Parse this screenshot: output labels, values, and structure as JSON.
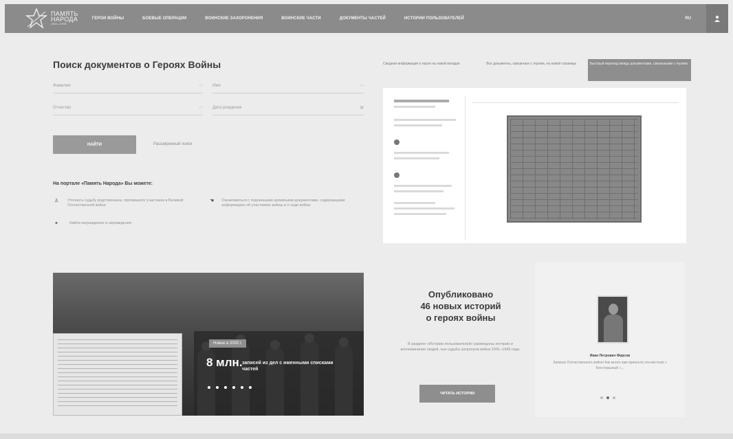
{
  "header": {
    "logo": {
      "line1": "Память",
      "line2": "Народа",
      "line3": "1941–1945"
    },
    "nav": [
      "Герои войны",
      "Боевые операции",
      "Воинские захоронения",
      "Воинские части",
      "Документы частей",
      "Истории пользователей"
    ],
    "lang": "RU"
  },
  "search": {
    "title": "Поиск документов о Героях Войны",
    "fields": {
      "last_name": "Фамилия",
      "first_name": "Имя",
      "patronymic": "Отчество",
      "birth_date": "Дата рождения"
    },
    "find_button": "Найти",
    "advanced_link": "Расширенный поиск"
  },
  "portal": {
    "title": "На портале «Память Народа» Вы можете:",
    "features": [
      "Уточнить судьбу родственника, пропавшего/ участника в Великой Отечественной войне",
      "Ознакомиться с подлинными архивными документами, содержащими информацию об участниках войны и о ходе войны",
      "Найти награждение и награждения"
    ]
  },
  "preview": {
    "tabs": [
      "Сводная информация о герое на новой вкладке",
      "Все документы, связанные с героем, на новой странице",
      "Быстрый переход между документами, связанными с героем"
    ]
  },
  "banner": {
    "badge": "Новое в 2020 г.",
    "big_number": "8 млн.",
    "big_text": "записей из дел с именными списками частей"
  },
  "stories": {
    "title_line1": "Опубликовано",
    "title_line2": "46 новых историй",
    "title_line3": "о героях войны",
    "text": "В разделе «Истории пользователей» размещены истории и воспоминания людей, чьи судьбы затронула война 1941–1945 года.",
    "button": "Читать истории"
  },
  "story_card": {
    "name": "Иван Петрович Фирсов",
    "text": "Записки Отечественного война! Как много нам принесла эта местная « Бесстрашный »..."
  },
  "colors": {
    "header_bg": "#8b8b8b",
    "page_bg": "#ececec",
    "button_bg": "#9a9a9a"
  }
}
